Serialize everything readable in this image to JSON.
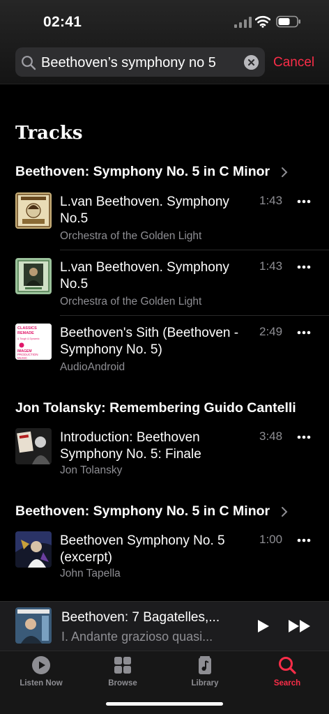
{
  "status": {
    "time": "02:41"
  },
  "search": {
    "query": "Beethoven’s symphony no 5",
    "cancel_label": "Cancel"
  },
  "tracks_title": "Tracks",
  "sections": [
    {
      "heading": "Beethoven: Symphony No. 5 in C Minor",
      "tracks": [
        {
          "title": "L.van Beethoven. Symphony No.5",
          "artist": "Orchestra of the Golden Light",
          "duration": "1:43"
        },
        {
          "title": "L.van Beethoven. Symphony No.5",
          "artist": "Orchestra of the Golden Light",
          "duration": "1:43"
        },
        {
          "title": "Beethoven's Sith (Beethoven - Symphony No. 5)",
          "artist": "AudioAndroid",
          "duration": "2:49",
          "art_text": [
            "CLASSICS",
            "REMADE",
            "& Tough & Dynamic",
            "IMAGEM",
            "PRODUCTION",
            "MUSIC"
          ]
        }
      ]
    },
    {
      "heading": "Jon Tolansky: Remembering Guido Cantelli",
      "tracks": [
        {
          "title": "Introduction: Beethoven Symphony No. 5: Finale",
          "artist": "Jon Tolansky",
          "duration": "3:48"
        }
      ]
    },
    {
      "heading": "Beethoven: Symphony No. 5 in C Minor",
      "tracks": [
        {
          "title": "Beethoven Symphony No. 5 (excerpt)",
          "artist": "John Tapella",
          "duration": "1:00"
        }
      ]
    }
  ],
  "mini_player": {
    "title": "Beethoven: 7 Bagatelles,...",
    "subtitle": "I. Andante grazioso quasi..."
  },
  "tabs": [
    {
      "label": "Listen Now",
      "icon": "play-circle-icon"
    },
    {
      "label": "Browse",
      "icon": "grid-icon"
    },
    {
      "label": "Library",
      "icon": "music-library-icon"
    },
    {
      "label": "Search",
      "icon": "search-icon",
      "active": true
    }
  ],
  "colors": {
    "accent": "#fa2d48",
    "secondary_text": "#8e8e93",
    "background": "#000000"
  }
}
